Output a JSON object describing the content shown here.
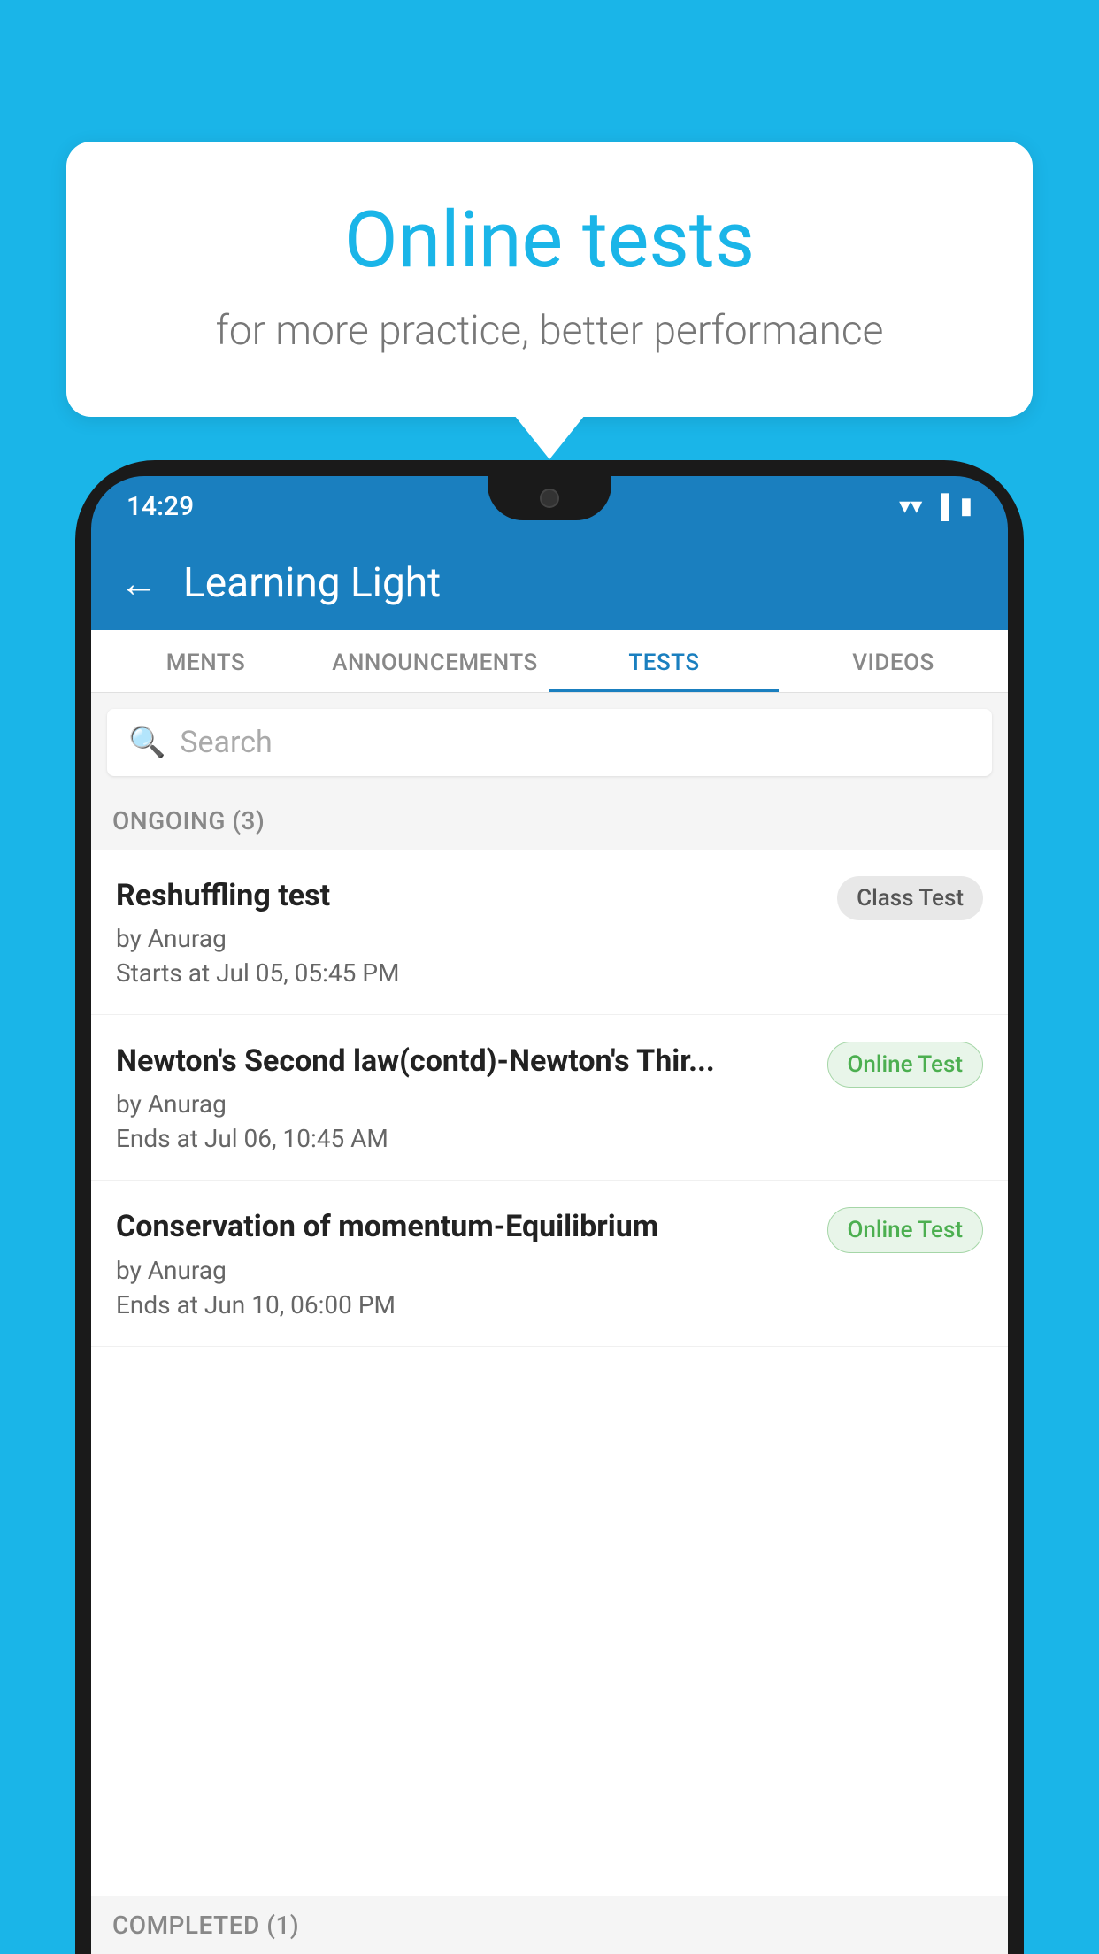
{
  "background_color": "#1ab5e8",
  "bubble": {
    "title": "Online tests",
    "subtitle": "for more practice, better performance"
  },
  "phone": {
    "status_bar": {
      "time": "14:29",
      "icons": [
        "wifi",
        "signal",
        "battery"
      ]
    },
    "toolbar": {
      "back_label": "←",
      "title": "Learning Light"
    },
    "tabs": [
      {
        "label": "MENTS",
        "active": false
      },
      {
        "label": "ANNOUNCEMENTS",
        "active": false
      },
      {
        "label": "TESTS",
        "active": true
      },
      {
        "label": "VIDEOS",
        "active": false
      }
    ],
    "search": {
      "placeholder": "Search"
    },
    "ongoing_section": {
      "header": "ONGOING (3)"
    },
    "tests": [
      {
        "name": "Reshuffling test",
        "author": "by Anurag",
        "time_label": "Starts at",
        "time": "Jul 05, 05:45 PM",
        "badge": "Class Test",
        "badge_type": "class"
      },
      {
        "name": "Newton's Second law(contd)-Newton's Thir...",
        "author": "by Anurag",
        "time_label": "Ends at",
        "time": "Jul 06, 10:45 AM",
        "badge": "Online Test",
        "badge_type": "online"
      },
      {
        "name": "Conservation of momentum-Equilibrium",
        "author": "by Anurag",
        "time_label": "Ends at",
        "time": "Jun 10, 06:00 PM",
        "badge": "Online Test",
        "badge_type": "online"
      }
    ],
    "completed_section": {
      "header": "COMPLETED (1)"
    }
  }
}
